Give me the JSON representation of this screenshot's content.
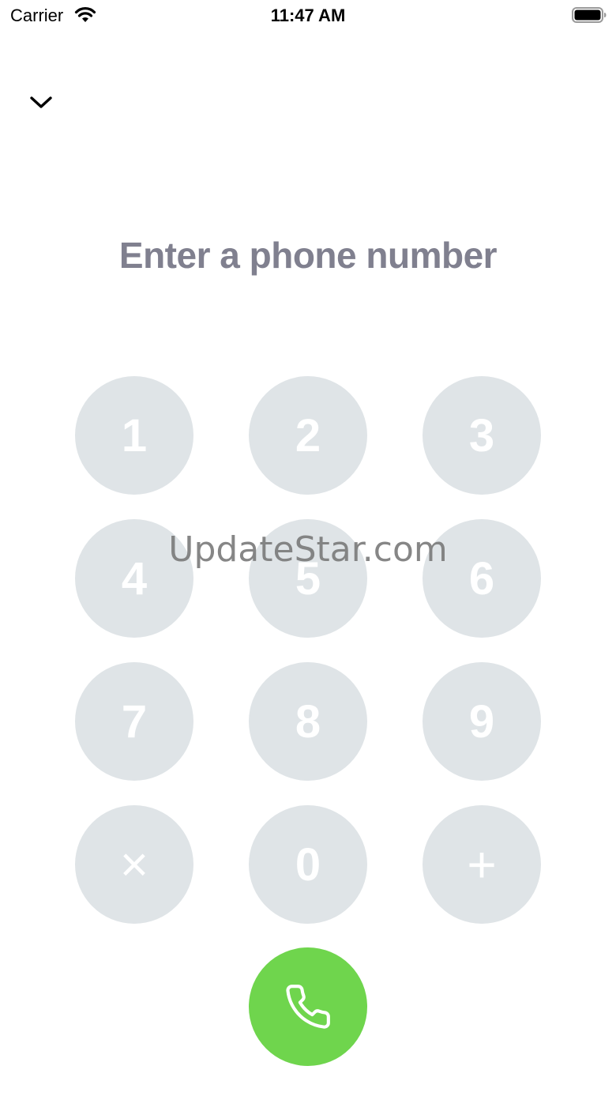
{
  "status_bar": {
    "carrier": "Carrier",
    "time": "11:47 AM",
    "wifi_icon": "wifi-icon",
    "battery_icon": "battery-full-icon"
  },
  "header": {
    "collapse_icon": "chevron-down-icon"
  },
  "title": "Enter a phone number",
  "keypad": {
    "keys": [
      "1",
      "2",
      "3",
      "4",
      "5",
      "6",
      "7",
      "8",
      "9",
      "×",
      "0",
      "+"
    ],
    "key_color": "#dfe4e7",
    "key_text_color": "#ffffff"
  },
  "call_button": {
    "icon": "phone-icon",
    "color": "#6fd54d"
  },
  "watermark": "UpdateStar.com"
}
